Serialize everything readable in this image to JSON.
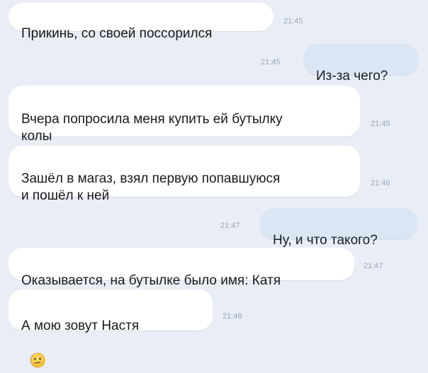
{
  "messages": [
    {
      "side": "in",
      "text": "Прикинь, со своей поссорился",
      "time": "21:45"
    },
    {
      "side": "out",
      "text": "Из-за чего?",
      "time": "21:45"
    },
    {
      "side": "in",
      "text": "Вчера попросила меня купить ей бутылку\nколы",
      "time": "21:45"
    },
    {
      "side": "in",
      "text": "Зашёл в магаз, взял первую попавшуюся\nи пошёл к ней",
      "time": "21:46"
    },
    {
      "side": "out",
      "text": "Ну, и что такого?",
      "time": "21:47"
    },
    {
      "side": "in",
      "text": "Оказывается, на бутылке было имя: Катя",
      "time": "21:47"
    },
    {
      "side": "in",
      "text": "А мою зовут Настя",
      "time": "21:48",
      "emoji": "confused-face-icon"
    }
  ],
  "colors": {
    "background": "#e9eef6",
    "incoming_bubble": "#ffffff",
    "outgoing_bubble": "#dbe6f5",
    "timestamp": "#9aa6b8"
  }
}
